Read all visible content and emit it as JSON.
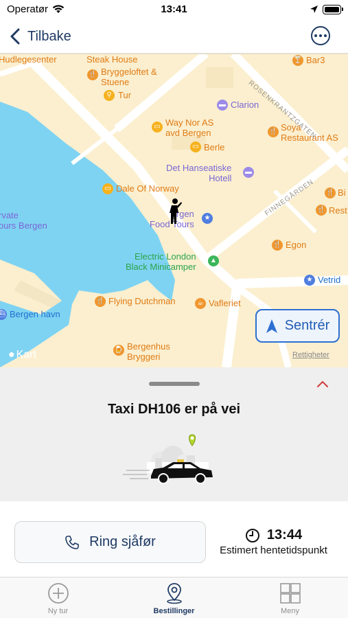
{
  "status_bar": {
    "carrier": "Operatør",
    "time": "13:41"
  },
  "nav": {
    "back_label": "Tilbake"
  },
  "map": {
    "pois": {
      "hudlegesenter": "Hudlegesenter",
      "steak_house": "Steak House",
      "bar3": "Bar3",
      "bryggeloftet": "Bryggeloftet &\nStuene",
      "tur": "Tur",
      "clarion": "Clarion",
      "way_nor": "Way Nor AS\navd Bergen",
      "soya": "Soya\nRestaurant AS",
      "berle": "Berle",
      "hanseatiske": "Det Hanseatiske\nHotell",
      "dale": "Dale Of Norway",
      "bi": "Bi",
      "rest": "Rest",
      "privat_tours": "rvate\nours Bergen",
      "bergen_food_tours": "rgen\nFood Tours",
      "egon": "Egon",
      "electric_london": "Electric London\nBlack Minicamper",
      "vetrid": "Vetrid",
      "flying_dutchman": "Flying Dutchman",
      "vafleriet": "Vafleriet",
      "bergen_havn": "Bergen havn",
      "bergenhus": "Bergenhus\nBryggeri",
      "rosenkrantz_street": "ROSENKRANTZGATEN",
      "finnegarden_street": "FINNEGÅRDEN"
    },
    "centre_label": "Sentrér",
    "brand": "Kart",
    "rights": "Rettigheter"
  },
  "sheet": {
    "title": "Taxi DH106 er på vei"
  },
  "actions": {
    "call_label": "Ring sjåfør",
    "eta_time": "13:44",
    "eta_label": "Estimert hentetidspunkt"
  },
  "tabs": [
    {
      "label": "Ny tur",
      "icon": "plus-circle-icon"
    },
    {
      "label": "Bestillinger",
      "icon": "location-pin-icon"
    },
    {
      "label": "Meny",
      "icon": "grid-icon"
    }
  ],
  "colors": {
    "accent": "#1f3a63",
    "map_land": "#fbefcf",
    "map_water": "#7fd3f2",
    "centre_button_blue": "#2d6fd2"
  }
}
